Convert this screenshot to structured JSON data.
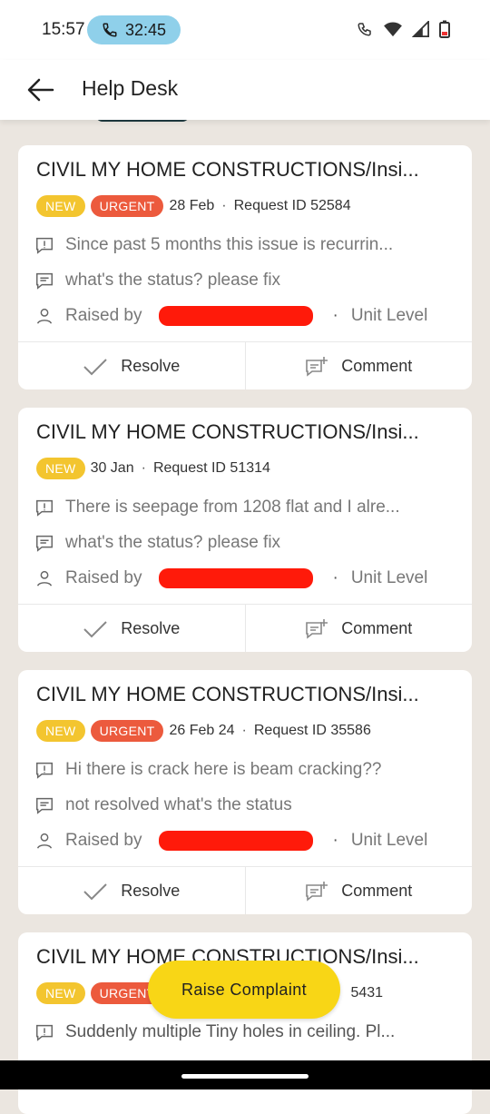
{
  "status_bar": {
    "time": "15:57",
    "call_timer": "32:45"
  },
  "header": {
    "title": "Help Desk"
  },
  "cards": [
    {
      "title": "CIVIL MY HOME CONSTRUCTIONS/Insi...",
      "badges": [
        "NEW",
        "URGENT"
      ],
      "date": "28 Feb",
      "request": "Request ID 52584",
      "issue": "Since past 5 months this issue is recurrin...",
      "comment": "what's the status? please fix",
      "raised_prefix": "Raised by",
      "level": "Unit Level"
    },
    {
      "title": "CIVIL MY HOME CONSTRUCTIONS/Insi...",
      "badges": [
        "NEW"
      ],
      "date": "30 Jan",
      "request": "Request ID 51314",
      "issue": "There is seepage from 1208 flat and I alre...",
      "comment": "what's the status? please fix",
      "raised_prefix": "Raised by",
      "level": "Unit Level"
    },
    {
      "title": "CIVIL MY HOME CONSTRUCTIONS/Insi...",
      "badges": [
        "NEW",
        "URGENT"
      ],
      "date": "26 Feb 24",
      "request": "Request ID 35586",
      "issue": "Hi there is crack here is beam cracking??",
      "comment": "not resolved what's the status",
      "raised_prefix": "Raised by",
      "level": "Unit Level"
    },
    {
      "title": "CIVIL MY HOME CONSTRUCTIONS/Insi...",
      "badges": [
        "NEW",
        "URGENT"
      ],
      "request_partial": "5431",
      "issue": "Suddenly multiple Tiny holes in ceiling. Pl..."
    }
  ],
  "actions": {
    "resolve": "Resolve",
    "comment": "Comment"
  },
  "fab": {
    "label": "Raise Complaint"
  },
  "colors": {
    "new_badge": "#f3c52f",
    "urgent_badge": "#ec5a3d",
    "fab": "#f8d616",
    "background": "#ebe6e0"
  }
}
